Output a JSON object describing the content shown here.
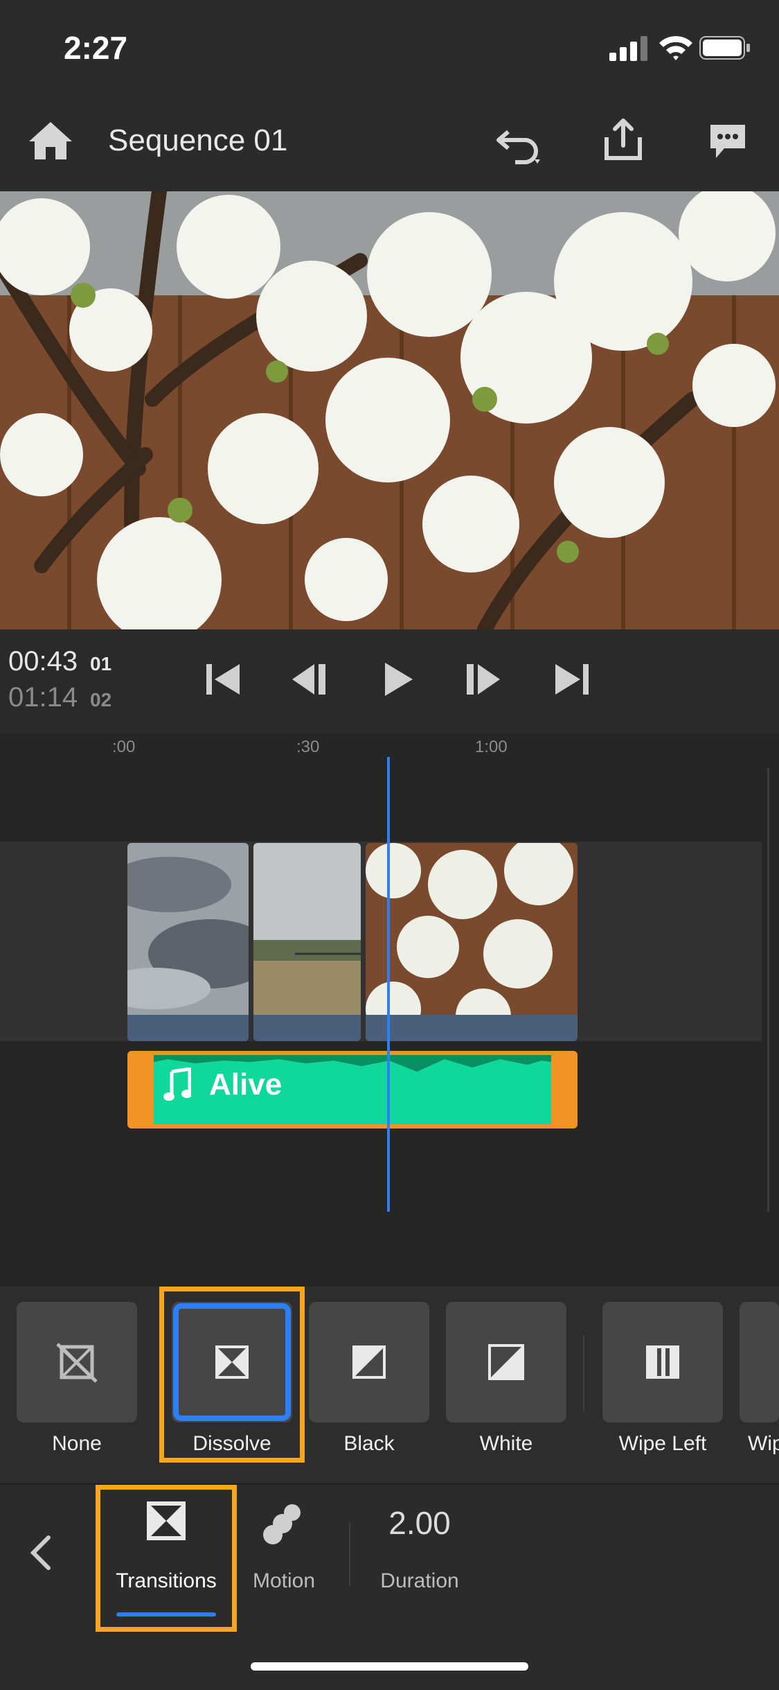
{
  "status_bar": {
    "time": "2:27"
  },
  "header": {
    "title": "Sequence 01"
  },
  "transport": {
    "current_time": "00:43",
    "current_frame": "01",
    "total_time": "01:14",
    "total_frame": "02"
  },
  "timeline": {
    "ruler": [
      ":00",
      ":30",
      "1:00"
    ],
    "audio_clip_name": "Alive"
  },
  "transitions": {
    "items": [
      {
        "label": "None",
        "icon": "none-icon"
      },
      {
        "label": "Dissolve",
        "icon": "dissolve-icon",
        "selected": true
      },
      {
        "label": "Black",
        "icon": "black-icon"
      },
      {
        "label": "White",
        "icon": "white-icon"
      },
      {
        "label": "Wipe Left",
        "icon": "wipe-left-icon"
      },
      {
        "label": "Wip",
        "icon": "wipe-right-icon"
      }
    ]
  },
  "bottom_bar": {
    "tabs": [
      {
        "label": "Transitions",
        "icon": "transitions-icon",
        "active": true
      },
      {
        "label": "Motion",
        "icon": "motion-icon"
      }
    ],
    "duration_value": "2.00",
    "duration_label": "Duration"
  },
  "colors": {
    "accent": "#2c7ff5",
    "highlight": "#f7a51c",
    "audio_clip": "#10d79a",
    "audio_clip_border": "#f29423"
  }
}
